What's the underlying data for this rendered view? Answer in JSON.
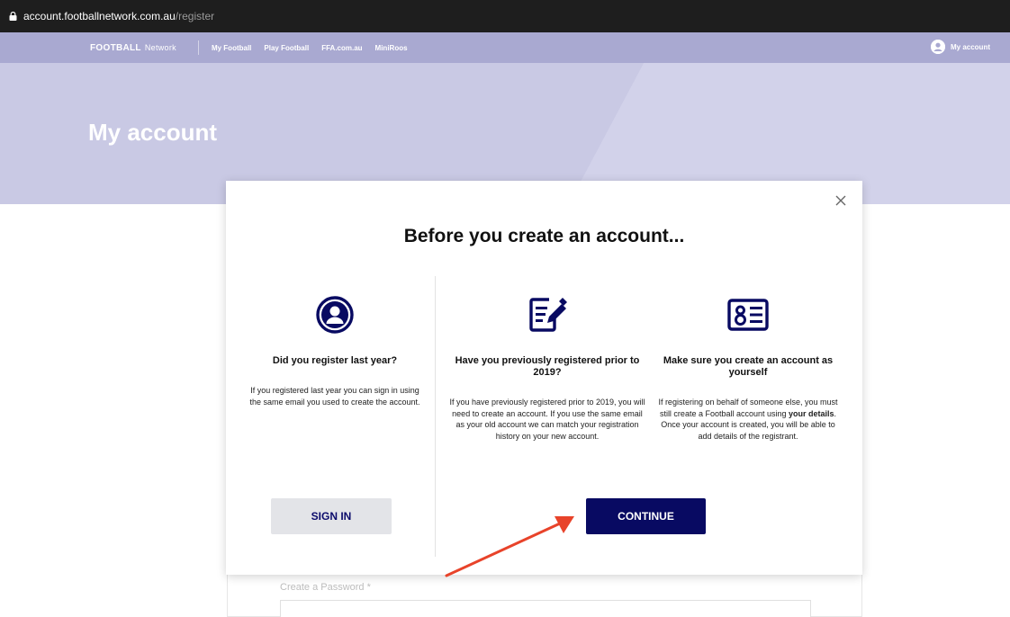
{
  "browser": {
    "url_host": "account.footballnetwork.com.au",
    "url_path": "/register"
  },
  "nav": {
    "logo_main": "FOOTBALL",
    "logo_sub": "Network",
    "links": [
      "My Football",
      "Play Football",
      "FFA.com.au",
      "MiniRoos"
    ],
    "account_label": "My account"
  },
  "hero": {
    "title": "My account"
  },
  "modal": {
    "title": "Before you create an account...",
    "columns": [
      {
        "icon": "user-circle-icon",
        "heading": "Did you register last year?",
        "body": "If you registered last year you can sign in using the same email you used to create the account."
      },
      {
        "icon": "edit-note-icon",
        "heading": "Have you previously registered prior to 2019?",
        "body": "If you have previously registered prior to 2019, you will need to create an account. If you use the same email as your old account we can match your registration history on your new account."
      },
      {
        "icon": "id-card-icon",
        "heading": "Make sure you create an account as yourself",
        "body_before": "If registering on behalf of someone else, you must still create a Football account using ",
        "body_bold": "your details",
        "body_after": ". Once your account is created, you will be able to add details of the registrant."
      }
    ],
    "signin_label": "SIGN IN",
    "continue_label": "CONTINUE"
  },
  "form": {
    "password_label": "Create a Password *"
  },
  "colors": {
    "nav_bg": "#a9a9d1",
    "hero_bg": "#c9c9e4",
    "brand_navy": "#080a62",
    "annotation_arrow": "#e8432a"
  }
}
